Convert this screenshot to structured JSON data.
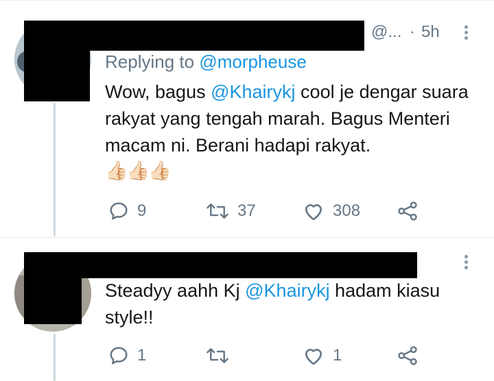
{
  "tweets": [
    {
      "handle": "@...",
      "separator": "·",
      "time": "5h",
      "reply_prefix": "Replying to ",
      "reply_mention": "@morpheuse",
      "text_1": "Wow, bagus ",
      "mention": "@Khairykj",
      "text_2": " cool je dengar suara rakyat yang tengah marah. Bagus Menteri macam ni. Berani hadapi rakyat.",
      "emoji": "👍🏻👍🏻👍🏻",
      "reply_count": "9",
      "retweet_count": "37",
      "like_count": "308"
    },
    {
      "text_1": "Steadyy aahh Kj ",
      "mention": "@Khairykj",
      "text_2": " hadam kiasu style!!",
      "reply_count": "1",
      "retweet_count": "",
      "like_count": "1"
    }
  ],
  "colors": {
    "muted": "#657786",
    "link": "#1b95e0",
    "text": "#14171a"
  }
}
